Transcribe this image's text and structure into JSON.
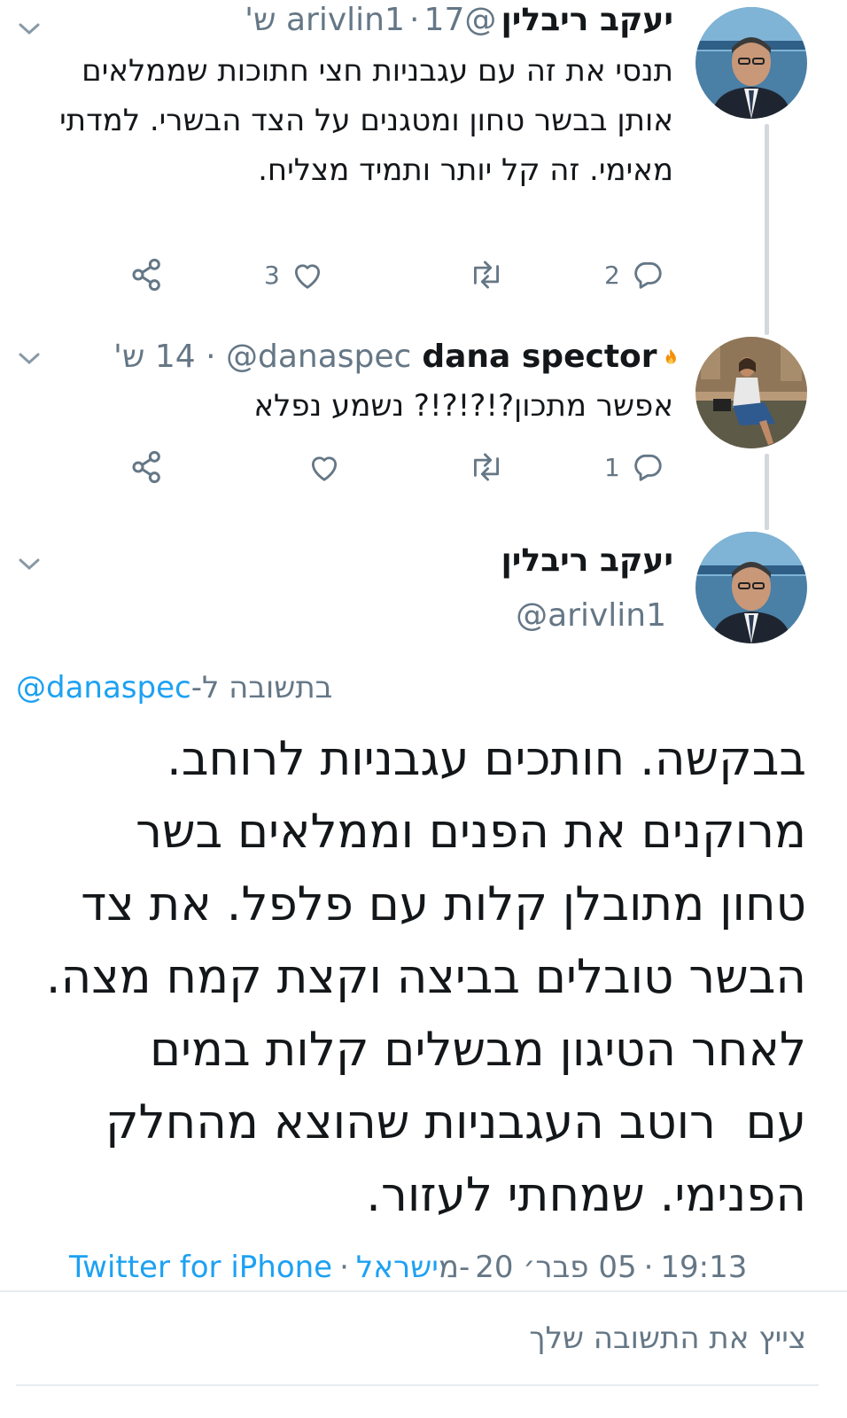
{
  "tweets": [
    {
      "author_name": "יעקב ריבלין",
      "handle": "@arivlin1",
      "time": "17 ש'",
      "text": "תנסי את זה עם עגבניות חצי חתוכות שממלאים אותן בבשר טחון ומטגנים על הצד הבשרי. למדתי מאימי. זה קל יותר ותמיד מצליח.",
      "replies": "2",
      "likes": "3"
    },
    {
      "author_name": "dana spector",
      "handle": "@danaspec",
      "time": "14 ש'",
      "text": "אפשר מתכון?!?!?!? נשמע נפלא",
      "replies": "1",
      "likes": ""
    }
  ],
  "focused": {
    "author_name": "יעקב ריבלין",
    "handle": "@arivlin1",
    "reply_prefix": "בתשובה ל-",
    "reply_to": "@danaspec",
    "lines": [
      "בבקשה. חותכים עגבניות לרוחב.",
      "מרוקנים את הפנים וממלאים בשר",
      "טחון מתובלן קלות עם פלפל. את צד",
      "הבשר טובלים בביצה וקצת קמח מצה.",
      "לאחר הטיגון מבשלים קלות במים",
      "עם  רוטב העגבניות שהוצא מהחלק",
      "הפנימי. שמחתי לעזור."
    ],
    "time": "19:13",
    "date": "05 פבר׳ 20",
    "location_prefix": "מ-",
    "location": "ישראל",
    "client": "Twitter for iPhone",
    "separator": "·"
  },
  "reply_box": {
    "placeholder": "צייץ את התשובה שלך"
  },
  "colors": {
    "accent": "#1da1f2",
    "muted": "#657786",
    "text": "#14171a",
    "thread_line": "#d2d8dd"
  },
  "icons": [
    "chevron-down-icon",
    "reply-icon",
    "retweet-icon",
    "like-icon",
    "share-icon",
    "fire-emoji-icon"
  ]
}
